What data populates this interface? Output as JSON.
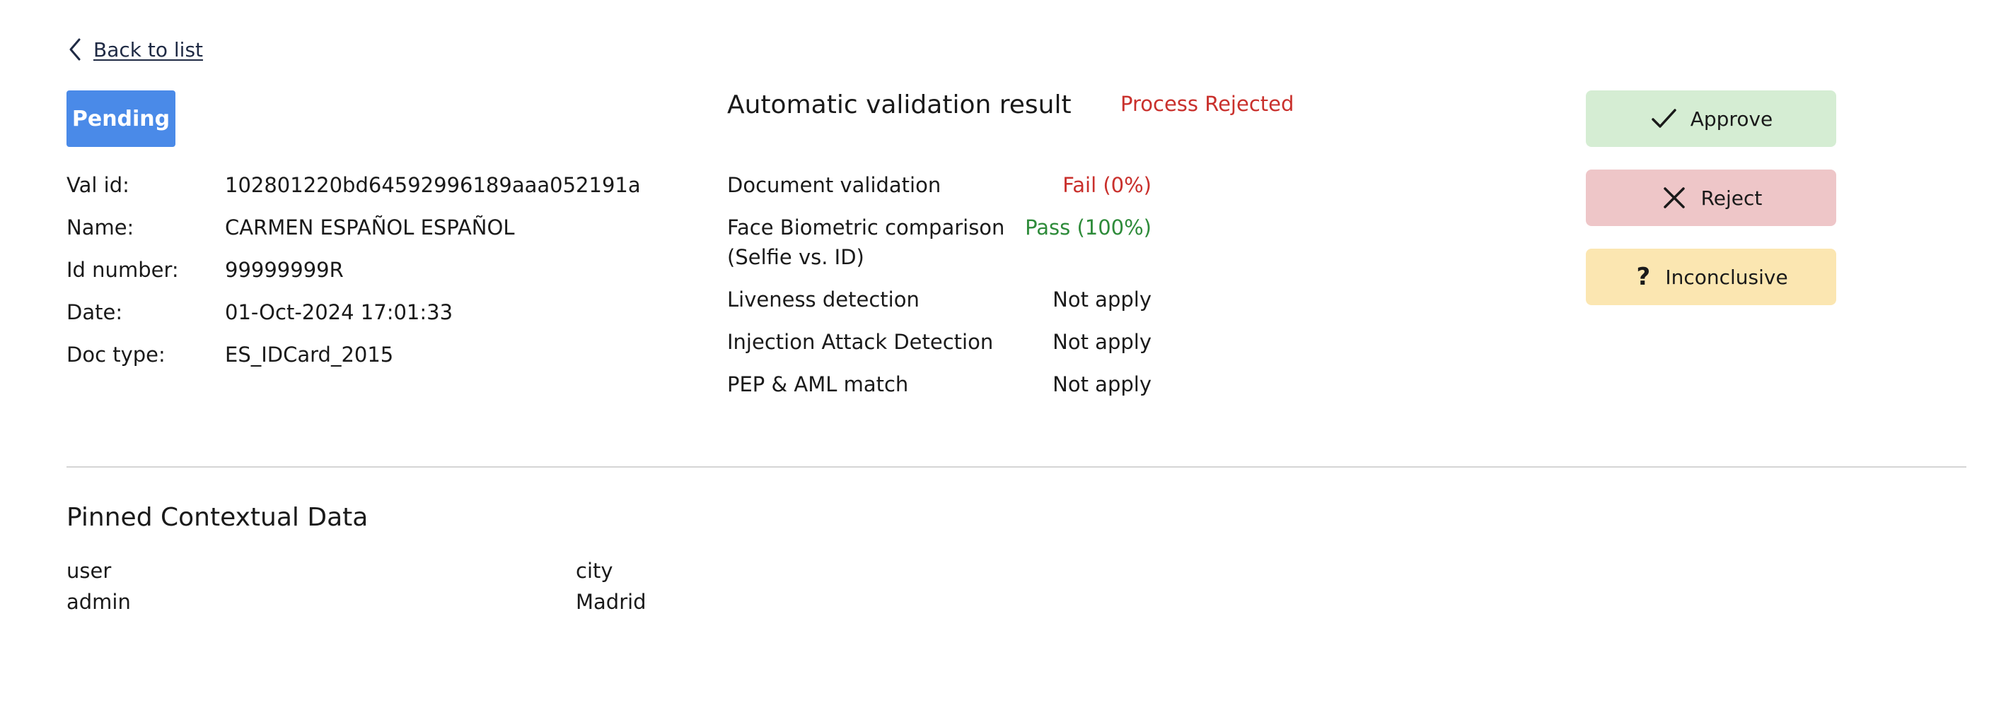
{
  "nav": {
    "back_label": "Back to list"
  },
  "status": {
    "label": "Pending",
    "color": "#4a8ae8"
  },
  "info": [
    {
      "key": "Val id:",
      "value": "102801220bd64592996189aaa052191a"
    },
    {
      "key": "Name:",
      "value": "CARMEN ESPAÑOL ESPAÑOL"
    },
    {
      "key": "Id number:",
      "value": "99999999R"
    },
    {
      "key": "Date:",
      "value": "01-Oct-2024 17:01:33"
    },
    {
      "key": "Doc type:",
      "value": "ES_IDCard_2015"
    }
  ],
  "automatic": {
    "title": "Automatic validation result",
    "result": "Process Rejected",
    "checks": [
      {
        "key": "Document validation",
        "value": "Fail (0%)",
        "status": "fail"
      },
      {
        "key": "Face Biometric comparison (Selfie vs. ID)",
        "value": "Pass (100%)",
        "status": "pass"
      },
      {
        "key": "Liveness detection",
        "value": "Not apply",
        "status": "na"
      },
      {
        "key": "Injection Attack Detection",
        "value": "Not apply",
        "status": "na"
      },
      {
        "key": "PEP & AML match",
        "value": "Not apply",
        "status": "na"
      }
    ]
  },
  "actions": {
    "approve": {
      "label": "Approve",
      "icon": "check-icon",
      "color": "#d5edd3"
    },
    "reject": {
      "label": "Reject",
      "icon": "x-icon",
      "color": "#eec6c8"
    },
    "inconclusive": {
      "label": "Inconclusive",
      "icon": "question-icon",
      "color": "#fbe6b1"
    }
  },
  "pinned": {
    "title": "Pinned Contextual Data",
    "columns": [
      {
        "header": "user",
        "value": "admin"
      },
      {
        "header": "city",
        "value": "Madrid"
      }
    ]
  },
  "colors": {
    "fail": "#c9302c",
    "pass": "#2e8b3a"
  }
}
